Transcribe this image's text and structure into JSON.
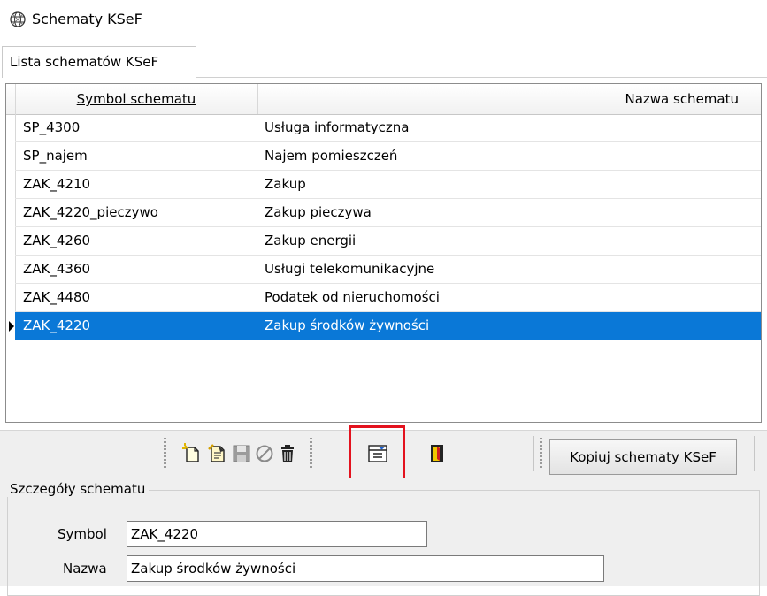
{
  "window": {
    "title": "Schematy KSeF",
    "icon": "scheme-globe-icon"
  },
  "tabs": [
    {
      "label": "Lista schematów KSeF",
      "active": true
    }
  ],
  "grid": {
    "columns": [
      "Symbol schematu",
      "Nazwa schematu"
    ],
    "rows": [
      {
        "symbol": "SP_4300",
        "name": "Usługa informatyczna"
      },
      {
        "symbol": "SP_najem",
        "name": "Najem pomieszczeń"
      },
      {
        "symbol": "ZAK_4210",
        "name": "Zakup"
      },
      {
        "symbol": "ZAK_4220_pieczywo",
        "name": "Zakup pieczywa"
      },
      {
        "symbol": "ZAK_4260",
        "name": "Zakup energii"
      },
      {
        "symbol": "ZAK_4360",
        "name": "Usługi telekomunikacyjne"
      },
      {
        "symbol": "ZAK_4480",
        "name": "Podatek od nieruchomości"
      },
      {
        "symbol": "ZAK_4220",
        "name": "Zakup środków żywności",
        "selected": true
      }
    ]
  },
  "toolbar": {
    "icons": [
      "new-icon",
      "edit-icon",
      "save-icon",
      "cancel-icon",
      "delete-icon",
      "list-settings-icon",
      "exit-icon"
    ],
    "copy_button": "Kopiuj schematy KSeF",
    "highlight_color": "#e3121e"
  },
  "details": {
    "legend": "Szczegóły schematu",
    "symbol_label": "Symbol",
    "symbol_value": "ZAK_4220",
    "name_label": "Nazwa",
    "name_value": "Zakup środków żywności"
  },
  "colors": {
    "selection": "#0a78d7"
  }
}
